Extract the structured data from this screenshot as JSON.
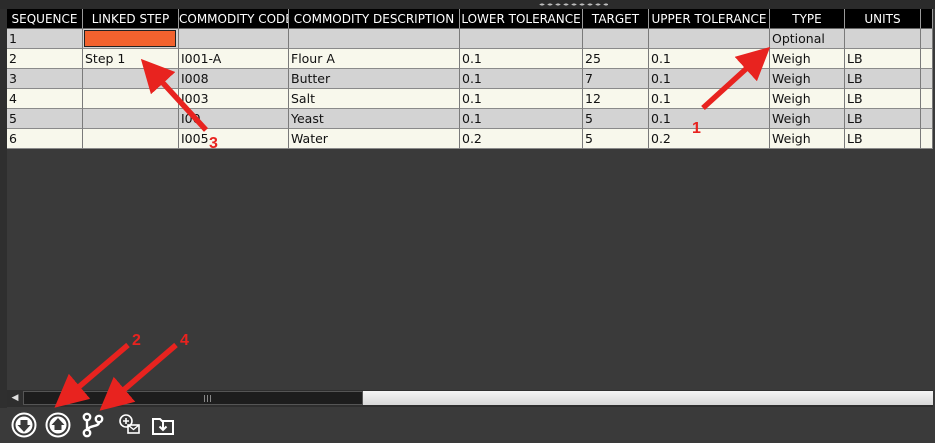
{
  "table": {
    "columns": [
      {
        "label": "SEQUENCE"
      },
      {
        "label": "LINKED STEP"
      },
      {
        "label": "COMMODITY CODE"
      },
      {
        "label": "COMMODITY DESCRIPTION"
      },
      {
        "label": "LOWER TOLERANCE"
      },
      {
        "label": "TARGET"
      },
      {
        "label": "UPPER TOLERANCE"
      },
      {
        "label": "TYPE"
      },
      {
        "label": "UNITS"
      },
      {
        "label": ""
      }
    ],
    "rows": [
      {
        "sequence": "1",
        "linked_step": "",
        "commodity_code": "",
        "commodity_description": "",
        "lower_tolerance": "",
        "target": "",
        "upper_tolerance": "",
        "type": "Optional",
        "units": ""
      },
      {
        "sequence": "2",
        "linked_step": "Step 1",
        "commodity_code": "I001-A",
        "commodity_description": "Flour A",
        "lower_tolerance": "0.1",
        "target": "25",
        "upper_tolerance": "0.1",
        "type": "Weigh",
        "units": "LB"
      },
      {
        "sequence": "3",
        "linked_step": "",
        "commodity_code": "I008",
        "commodity_description": "Butter",
        "lower_tolerance": "0.1",
        "target": "7",
        "upper_tolerance": "0.1",
        "type": "Weigh",
        "units": "LB"
      },
      {
        "sequence": "4",
        "linked_step": "",
        "commodity_code": "I003",
        "commodity_description": "Salt",
        "lower_tolerance": "0.1",
        "target": "12",
        "upper_tolerance": "0.1",
        "type": "Weigh",
        "units": "LB"
      },
      {
        "sequence": "5",
        "linked_step": "",
        "commodity_code": "I00",
        "commodity_description": "Yeast",
        "lower_tolerance": "0.1",
        "target": "5",
        "upper_tolerance": "0.1",
        "type": "Weigh",
        "units": "LB"
      },
      {
        "sequence": "6",
        "linked_step": "",
        "commodity_code": "I005",
        "commodity_description": "Water",
        "lower_tolerance": "0.2",
        "target": "5",
        "upper_tolerance": "0.2",
        "type": "Weigh",
        "units": "LB"
      }
    ],
    "selected_cell_color": "#f2622e"
  },
  "annotations": {
    "color": "#e8231f",
    "labels": [
      "1",
      "2",
      "3",
      "4"
    ]
  },
  "toolbar": {
    "buttons": [
      {
        "icon": "move-down-circle-icon"
      },
      {
        "icon": "move-up-circle-icon"
      },
      {
        "icon": "branch-icon"
      },
      {
        "icon": "add-message-icon"
      },
      {
        "icon": "import-folder-icon"
      }
    ]
  }
}
